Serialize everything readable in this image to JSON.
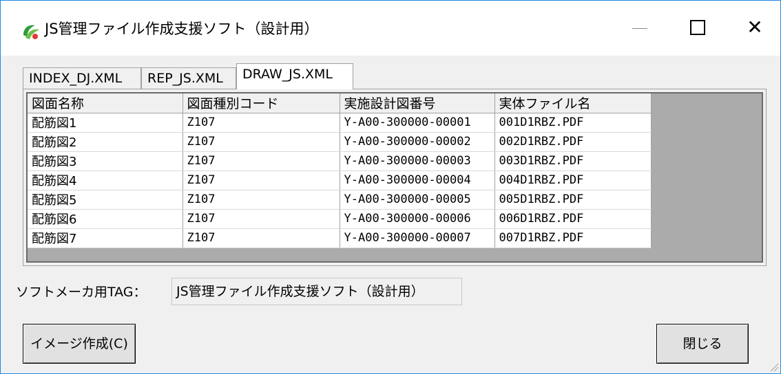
{
  "window": {
    "title": "JS管理ファイル作成支援ソフト（設計用）",
    "controls": {
      "minimize": "—",
      "maximize": "□",
      "close": "✕"
    }
  },
  "tabs": [
    {
      "label": "INDEX_DJ.XML",
      "active": false
    },
    {
      "label": "REP_JS.XML",
      "active": false
    },
    {
      "label": "DRAW_JS.XML",
      "active": true
    }
  ],
  "grid": {
    "columns": [
      "図面名称",
      "図面種別コード",
      "実施設計図番号",
      "実体ファイル名"
    ],
    "rows": [
      [
        "配筋図1",
        "Z107",
        "Y-A00-300000-00001",
        "001D1RBZ.PDF"
      ],
      [
        "配筋図2",
        "Z107",
        "Y-A00-300000-00002",
        "002D1RBZ.PDF"
      ],
      [
        "配筋図3",
        "Z107",
        "Y-A00-300000-00003",
        "003D1RBZ.PDF"
      ],
      [
        "配筋図4",
        "Z107",
        "Y-A00-300000-00004",
        "004D1RBZ.PDF"
      ],
      [
        "配筋図5",
        "Z107",
        "Y-A00-300000-00005",
        "005D1RBZ.PDF"
      ],
      [
        "配筋図6",
        "Z107",
        "Y-A00-300000-00006",
        "006D1RBZ.PDF"
      ],
      [
        "配筋図7",
        "Z107",
        "Y-A00-300000-00007",
        "007D1RBZ.PDF"
      ]
    ]
  },
  "tag": {
    "label": "ソフトメーカ用TAG：",
    "value": "JS管理ファイル作成支援ソフト（設計用）"
  },
  "buttons": {
    "create_image": "イメージ作成(C)",
    "close": "閉じる"
  },
  "colors": {
    "window_border": "#1e88e5",
    "grid_empty_area": "#ababab",
    "dialog_bg": "#f0f0f0"
  }
}
